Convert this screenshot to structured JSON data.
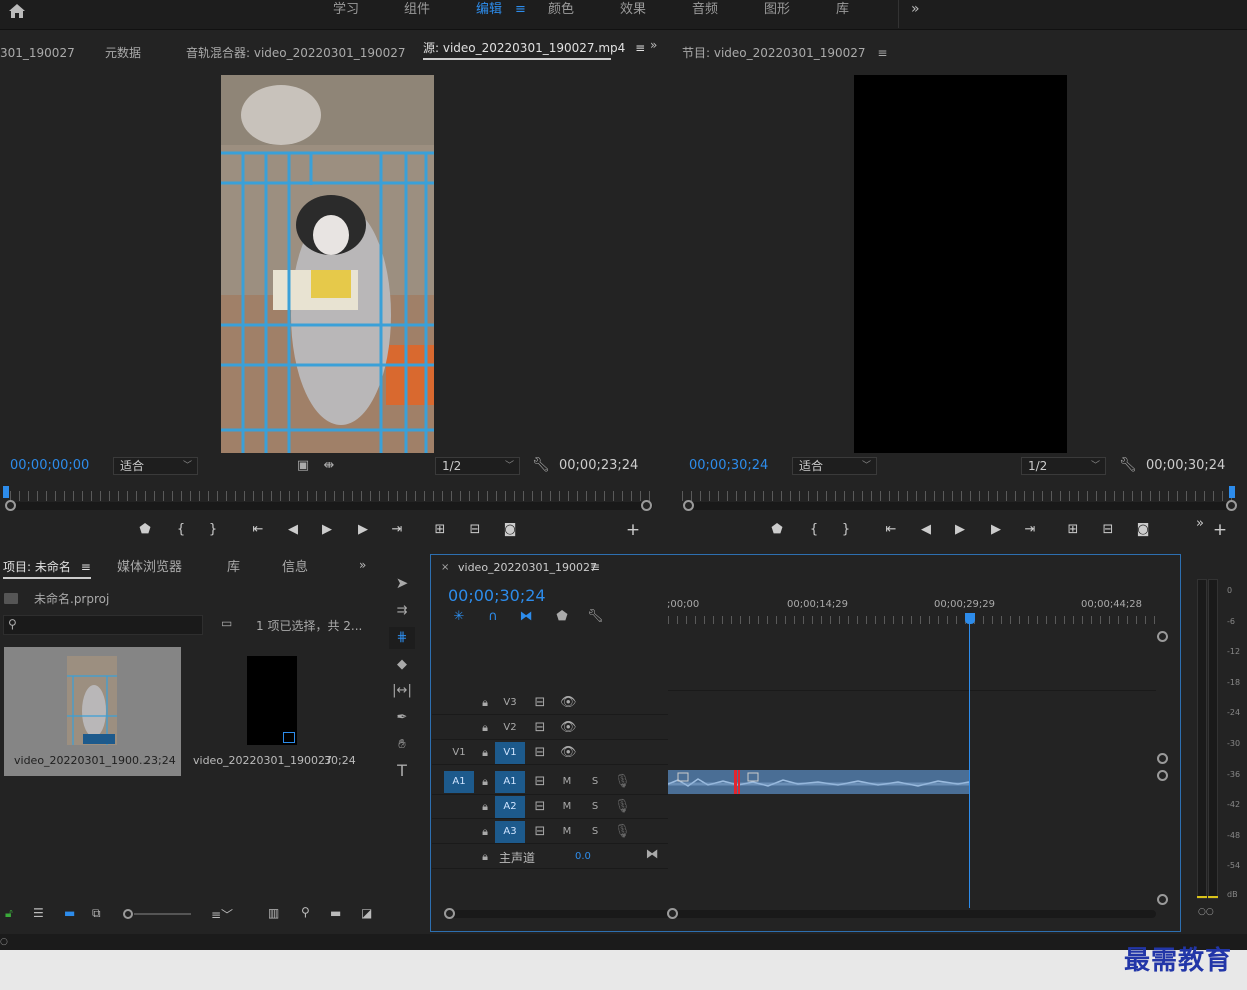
{
  "workspace_tabs": [
    {
      "label": "学习",
      "active": false
    },
    {
      "label": "组件",
      "active": false
    },
    {
      "label": "编辑",
      "active": true
    },
    {
      "label": "颜色",
      "active": false
    },
    {
      "label": "效果",
      "active": false
    },
    {
      "label": "音频",
      "active": false
    },
    {
      "label": "图形",
      "active": false
    },
    {
      "label": "库",
      "active": false
    }
  ],
  "source_panel": {
    "tabs": [
      "301_190027",
      "元数据",
      "音轨混合器: video_20220301_190027",
      "源: video_20220301_190027.mp4"
    ],
    "timecode_left": "00;00;00;00",
    "fit_value": "适合",
    "quality_value": "1/2",
    "timecode_right": "00;00;23;24"
  },
  "program_panel": {
    "title": "节目: video_20220301_190027",
    "timecode_left": "00;00;30;24",
    "fit_value": "适合",
    "quality_value": "1/2",
    "timecode_right": "00;00;30;24"
  },
  "project_panel": {
    "tabs": [
      "项目: 未命名",
      "媒体浏览器",
      "库",
      "信息"
    ],
    "file_name": "未命名.prproj",
    "selection_info": "1 项已选择，共 2...",
    "search_placeholder": "",
    "items": [
      {
        "name": "video_20220301_1900...",
        "duration": "23;24"
      },
      {
        "name": "video_20220301_190027",
        "duration": "30;24"
      }
    ]
  },
  "timeline": {
    "tab_title": "video_20220301_190027",
    "timecode": "00;00;30;24",
    "ruler_labels": [
      ";00;00",
      "00;00;14;29",
      "00;00;29;29",
      "00;00;44;28"
    ],
    "video_tracks": [
      {
        "src": "",
        "name": "V3"
      },
      {
        "src": "",
        "name": "V2"
      },
      {
        "src": "V1",
        "name": "V1"
      }
    ],
    "audio_tracks": [
      {
        "src": "A1",
        "name": "A1",
        "m": "M",
        "s": "S"
      },
      {
        "src": "",
        "name": "A2",
        "m": "M",
        "s": "S"
      },
      {
        "src": "",
        "name": "A3",
        "m": "M",
        "s": "S"
      }
    ],
    "master_label": "主声道",
    "master_value": "0.0"
  },
  "meter": {
    "labels": [
      "0",
      "-6",
      "-12",
      "-18",
      "-24",
      "-30",
      "-36",
      "-42",
      "-48",
      "-54",
      "dB"
    ]
  },
  "watermark": "最需教育",
  "colors": {
    "accent": "#2d8ceb",
    "playhead_red": "#e3262e",
    "clip_blue": "#4a6e95"
  }
}
